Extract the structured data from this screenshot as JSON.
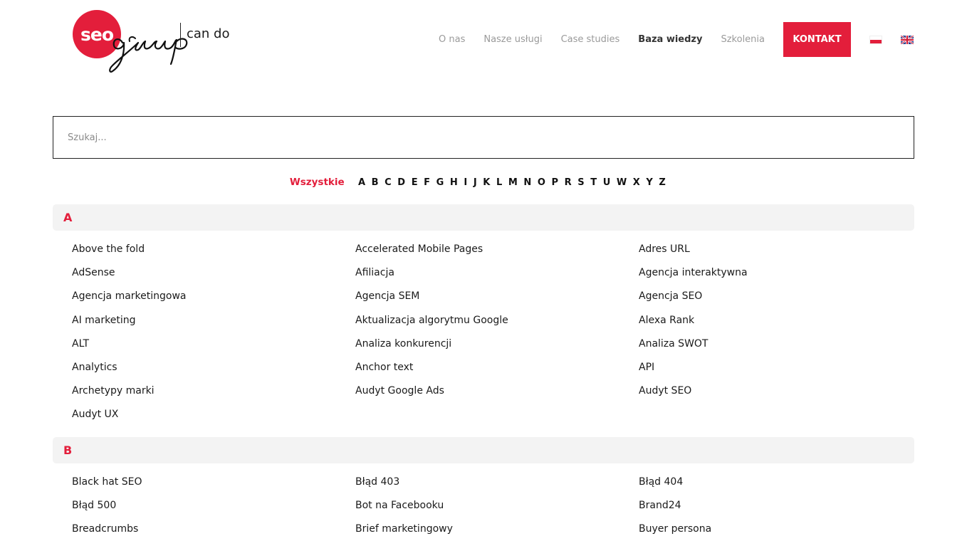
{
  "logo": {
    "badge": "seo",
    "script_word": "group",
    "tagline": "can do"
  },
  "nav": {
    "items": [
      {
        "label": "O nas"
      },
      {
        "label": "Nasze usługi"
      },
      {
        "label": "Case studies"
      },
      {
        "label": "Baza wiedzy",
        "active": true
      },
      {
        "label": "Szkolenia"
      }
    ],
    "contact_label": "KONTAKT",
    "languages": [
      {
        "icon": "flag-pl-icon"
      },
      {
        "icon": "flag-en-icon"
      }
    ]
  },
  "search": {
    "placeholder": "Szukaj...",
    "value": ""
  },
  "alphabet": {
    "all_label": "Wszystkie",
    "letters": [
      "A",
      "B",
      "C",
      "D",
      "E",
      "F",
      "G",
      "H",
      "I",
      "J",
      "K",
      "L",
      "M",
      "N",
      "O",
      "P",
      "R",
      "S",
      "T",
      "U",
      "W",
      "X",
      "Y",
      "Z"
    ]
  },
  "sections": [
    {
      "letter": "A",
      "terms": [
        "Above the fold",
        "Accelerated Mobile Pages",
        "Adres URL",
        "AdSense",
        "Afiliacja",
        "Agencja interaktywna",
        "Agencja marketingowa",
        "Agencja SEM",
        "Agencja SEO",
        "AI marketing",
        "Aktualizacja algorytmu Google",
        "Alexa Rank",
        "ALT",
        "Analiza konkurencji",
        "Analiza SWOT",
        "Analytics",
        "Anchor text",
        "API",
        "Archetypy marki",
        "Audyt Google Ads",
        "Audyt SEO",
        "Audyt UX"
      ]
    },
    {
      "letter": "B",
      "terms": [
        "Black hat SEO",
        "Błąd 403",
        "Błąd 404",
        "Błąd 500",
        "Bot na Facebooku",
        "Brand24",
        "Breadcrumbs",
        "Brief marketingowy",
        "Buyer persona"
      ]
    }
  ],
  "colors": {
    "accent": "#e31e3b",
    "section_bg": "#f3f3f3"
  }
}
